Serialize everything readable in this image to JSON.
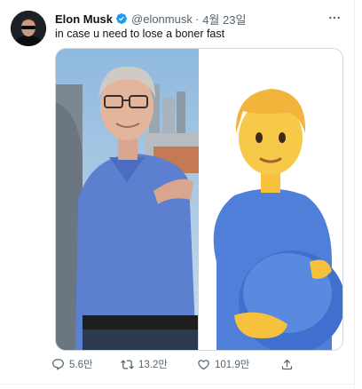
{
  "tweet": {
    "display_name": "Elon Musk",
    "handle": "@elonmusk",
    "separator": "·",
    "date": "4월 23일",
    "text": "in case u need to lose a boner fast"
  },
  "actions": {
    "replies": "5.6만",
    "retweets": "13.2만",
    "likes": "101.9만"
  },
  "colors": {
    "verified": "#1d9bf0",
    "secondary_text": "#536471",
    "border": "#cfd9de"
  }
}
